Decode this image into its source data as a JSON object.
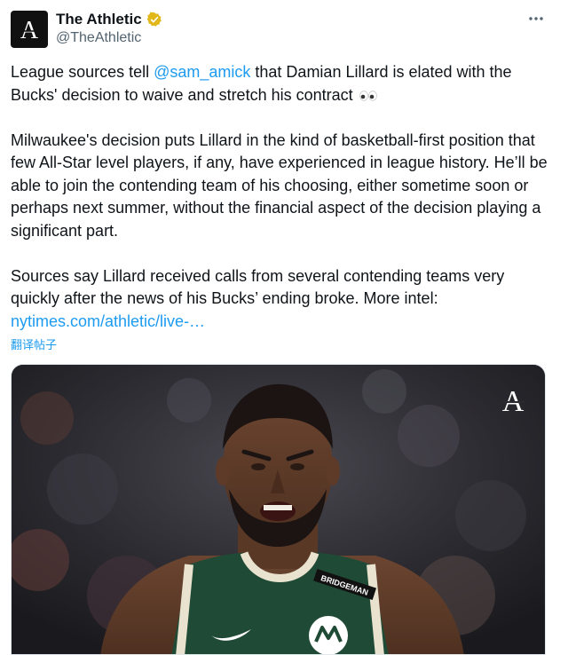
{
  "author": {
    "display_name": "The Athletic",
    "handle": "@TheAthletic",
    "avatar_letter": "A",
    "verified_badge_color": "#e2b719"
  },
  "tweet": {
    "p1_before": "League sources tell ",
    "p1_mention": "@sam_amick",
    "p1_after": " that Damian Lillard is elated with the Bucks' decision to waive and stretch his contract",
    "p1_emoji": "eyes-emoji",
    "p2": "Milwaukee's decision puts Lillard in the kind of basketball-first position that few All-Star level players, if any, have experienced in league history. He’ll be able to join the contending team of his choosing, either sometime soon or perhaps next summer, without the financial aspect of the decision playing a significant part.",
    "p3_text": "Sources say Lillard received calls from several contending teams very quickly after the news of his Bucks’ ending broke. More intel: ",
    "p3_link": "nytimes.com/athletic/live-…"
  },
  "translate_label": "翻译帖子",
  "media": {
    "watermark_letter": "A",
    "jersey_patch_text": "BRIDGEMAN",
    "accent_green": "#1f4a35"
  },
  "colors": {
    "link": "#1d9bf0",
    "text": "#0f1419",
    "secondary": "#536471"
  }
}
